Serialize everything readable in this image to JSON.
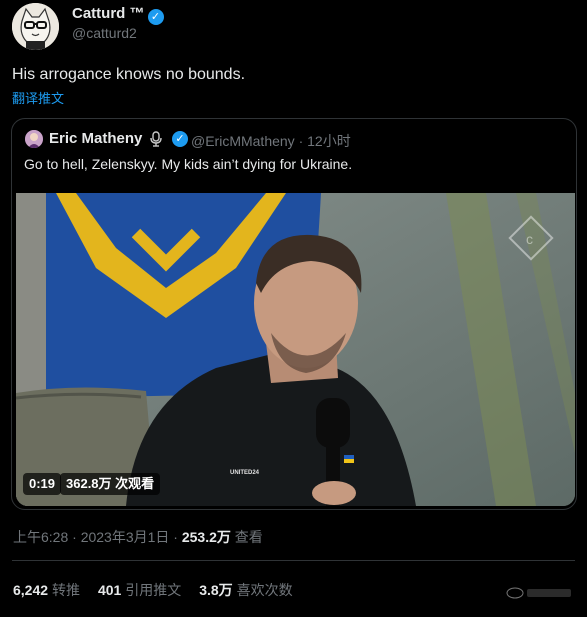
{
  "author": {
    "name": "Catturd ™",
    "handle": "@catturd2"
  },
  "tweet": {
    "text": "His arrogance knows no bounds.",
    "translate_label": "翻译推文"
  },
  "quote": {
    "name": "Eric Matheny",
    "handle_time": "@EricMMatheny · 12小时",
    "text": "Go to hell, Zelenskyy. My kids ain’t dying for Ukraine."
  },
  "video": {
    "duration": "0:19",
    "views": "362.8万 次观看",
    "shirt_text": "UNITED24"
  },
  "meta": {
    "timestamp": "上午6:28 · 2023年3月1日 · ",
    "views_count": "253.2万",
    "views_label": " 查看"
  },
  "stats": {
    "retweets_count": "6,242",
    "retweets_label": "转推",
    "quotes_count": "401",
    "quotes_label": "引用推文",
    "likes_count": "3.8万",
    "likes_label": "喜欢次数"
  },
  "colors": {
    "accent": "#1d9bf0",
    "muted": "#71767b",
    "text": "#e7e9ea",
    "border": "#2f3336"
  }
}
